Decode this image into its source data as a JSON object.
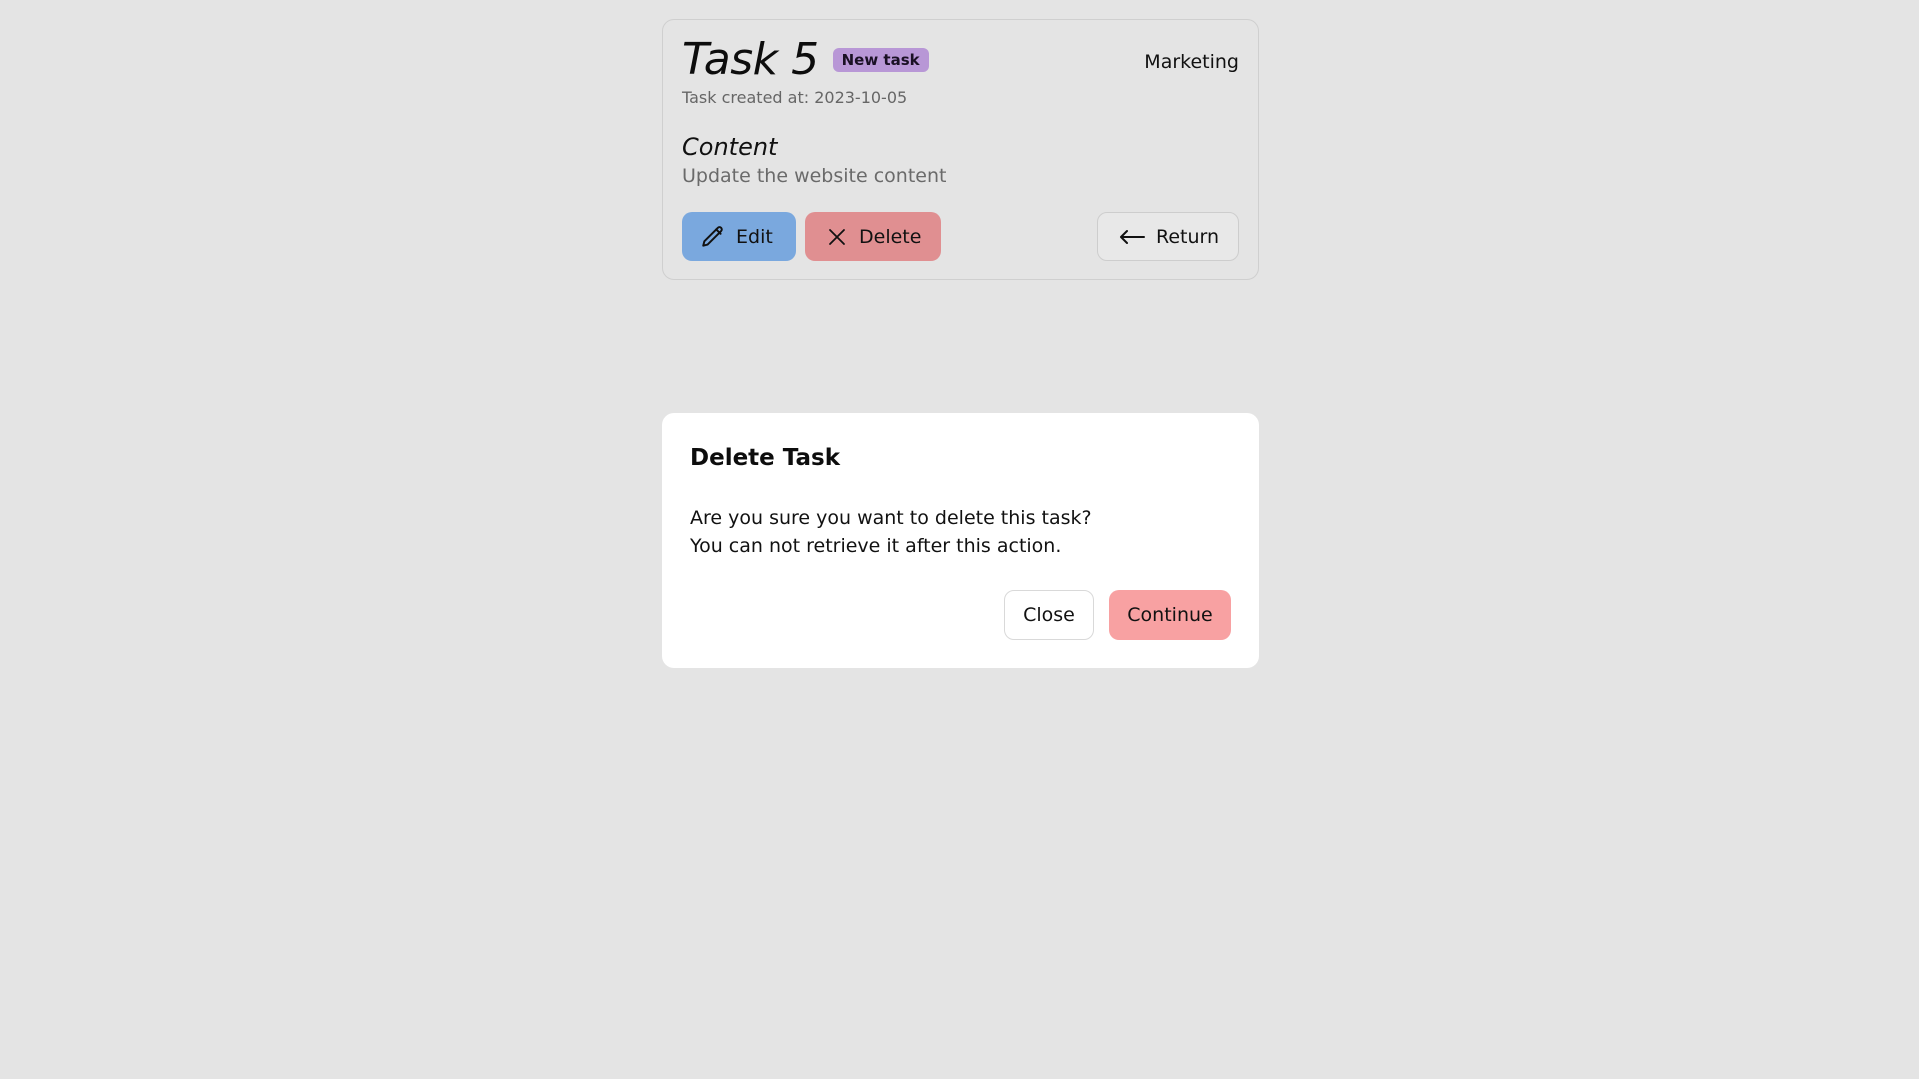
{
  "task": {
    "title": "Task 5",
    "badge": "New task",
    "category": "Marketing",
    "created_at": "Task created at: 2023-10-05",
    "section_title": "Content",
    "description": "Update the website content",
    "buttons": {
      "edit_label": "Edit",
      "delete_label": "Delete",
      "return_label": "Return"
    },
    "icons": {
      "edit": "pencil-icon",
      "delete": "close-x-icon",
      "return": "arrow-left-icon"
    }
  },
  "modal": {
    "title": "Delete Task",
    "line1": "Are you sure you want to delete this task?",
    "line2": "You can not retrieve it after this action.",
    "close_label": "Close",
    "continue_label": "Continue"
  },
  "colors": {
    "background": "#e4e4e4",
    "badge": "#b897d6",
    "edit_button": "#7aa8de",
    "delete_button": "#e08f91",
    "continue_button": "#f8a1a2"
  }
}
